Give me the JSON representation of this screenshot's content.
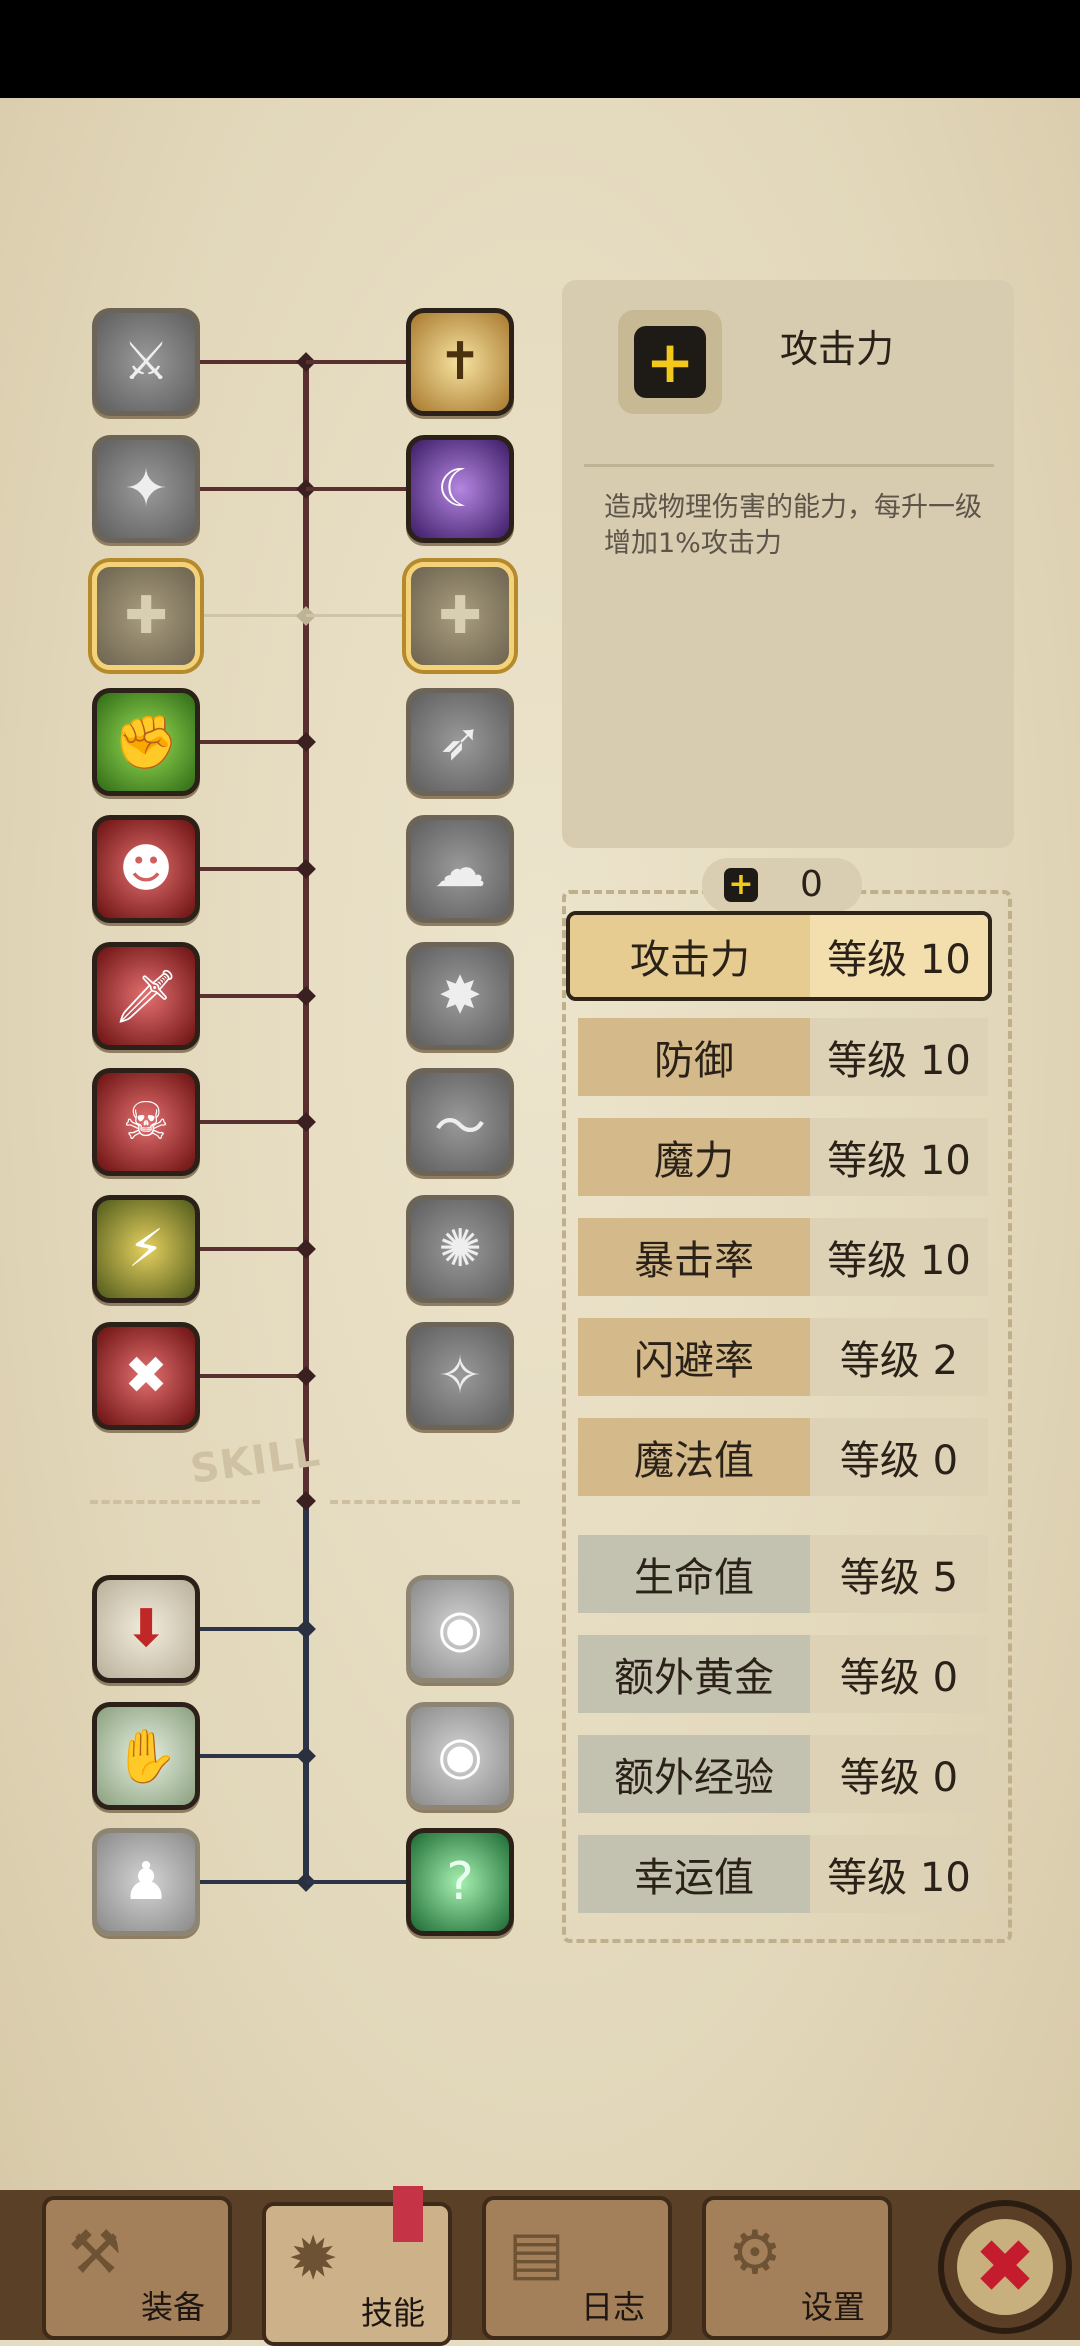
{
  "skills": {
    "left_column": [
      {
        "icon": "blade-slash-icon",
        "glyph": "⚔",
        "style": "gray",
        "state": "locked"
      },
      {
        "icon": "dodge-figure-icon",
        "glyph": "✦",
        "style": "gray",
        "state": "locked"
      },
      {
        "icon": "add-slot-icon",
        "glyph": "✚",
        "style": "locked",
        "state": "available"
      },
      {
        "icon": "muscle-arm-icon",
        "glyph": "✊",
        "style": "green",
        "state": "learned"
      },
      {
        "icon": "rage-warrior-icon",
        "glyph": "☻",
        "style": "red",
        "state": "learned"
      },
      {
        "icon": "dagger-icon",
        "glyph": "🗡",
        "style": "red",
        "state": "learned"
      },
      {
        "icon": "shadow-ninja-icon",
        "glyph": "☠",
        "style": "red",
        "state": "learned"
      },
      {
        "icon": "lightning-warrior-icon",
        "glyph": "⚡",
        "style": "yellowgreen",
        "state": "learned"
      },
      {
        "icon": "crossed-swords-icon",
        "glyph": "✖",
        "style": "red",
        "state": "learned"
      },
      {
        "icon": "treasure-drop-icon",
        "glyph": "⬇",
        "style": "ring",
        "state": "learned"
      },
      {
        "icon": "treasure-chest-hand-icon",
        "glyph": "✋",
        "style": "ringgreen",
        "state": "learned"
      },
      {
        "icon": "ghost-figure-icon",
        "glyph": "♟",
        "style": "ltgray",
        "state": "locked"
      }
    ],
    "right_column": [
      {
        "icon": "cross-shield-icon",
        "glyph": "✝",
        "style": "gold",
        "state": "learned"
      },
      {
        "icon": "dark-mage-icon",
        "glyph": "☾",
        "style": "purple",
        "state": "learned"
      },
      {
        "icon": "add-slot-icon",
        "glyph": "✚",
        "style": "locked",
        "state": "available"
      },
      {
        "icon": "dash-runner-icon",
        "glyph": "➶",
        "style": "gray",
        "state": "locked"
      },
      {
        "icon": "meditation-icon",
        "glyph": "☁",
        "style": "gray",
        "state": "locked"
      },
      {
        "icon": "burst-rock-icon",
        "glyph": "✸",
        "style": "gray",
        "state": "locked"
      },
      {
        "icon": "sword-wave-icon",
        "glyph": "〜",
        "style": "gray",
        "state": "locked"
      },
      {
        "icon": "explosion-icon",
        "glyph": "✺",
        "style": "gray",
        "state": "locked"
      },
      {
        "icon": "sparkle-figure-icon",
        "glyph": "✧",
        "style": "gray",
        "state": "locked"
      },
      {
        "icon": "eye-chest-icon",
        "glyph": "◉",
        "style": "ltgray",
        "state": "locked"
      },
      {
        "icon": "eye-chest-icon",
        "glyph": "◉",
        "style": "ltgray",
        "state": "locked"
      },
      {
        "icon": "mystery-figure-icon",
        "glyph": "?",
        "style": "teal",
        "state": "learned"
      }
    ],
    "divider_label": "SKILL"
  },
  "detail": {
    "icon": "plus-icon",
    "glyph": "+",
    "title": "攻击力",
    "description": "造成物理伤害的能力，每升一级增加1%攻击力"
  },
  "points": {
    "icon": "plus-icon",
    "glyph": "+",
    "value": "0"
  },
  "stats": [
    {
      "name": "攻击力",
      "level": "等级 10",
      "group": "attack",
      "selected": true
    },
    {
      "name": "防御",
      "level": "等级 10",
      "group": "attack",
      "selected": false
    },
    {
      "name": "魔力",
      "level": "等级 10",
      "group": "attack",
      "selected": false
    },
    {
      "name": "暴击率",
      "level": "等级 10",
      "group": "attack",
      "selected": false
    },
    {
      "name": "闪避率",
      "level": "等级 2",
      "group": "attack",
      "selected": false
    },
    {
      "name": "魔法值",
      "level": "等级 0",
      "group": "attack",
      "selected": false
    },
    {
      "name": "生命值",
      "level": "等级 5",
      "group": "util",
      "selected": false
    },
    {
      "name": "额外黄金",
      "level": "等级 0",
      "group": "util",
      "selected": false
    },
    {
      "name": "额外经验",
      "level": "等级 0",
      "group": "util",
      "selected": false
    },
    {
      "name": "幸运值",
      "level": "等级 10",
      "group": "util",
      "selected": false
    }
  ],
  "tabs": [
    {
      "label": "装备",
      "icon": "axe-icon",
      "glyph": "⚒",
      "active": false
    },
    {
      "label": "技能",
      "icon": "burst-icon",
      "glyph": "✹",
      "active": true
    },
    {
      "label": "日志",
      "icon": "book-icon",
      "glyph": "▤",
      "active": false
    },
    {
      "label": "设置",
      "icon": "gear-icon",
      "glyph": "⚙",
      "active": false
    }
  ],
  "close": {
    "icon": "close-icon",
    "glyph": "✖"
  },
  "colors": {
    "parchment": "#e6dcc2",
    "tree_line_top": "#5a2f30",
    "tree_line_bottom": "#2c3548",
    "highlight": "#f3d27a",
    "close_red": "#c41c2c"
  }
}
